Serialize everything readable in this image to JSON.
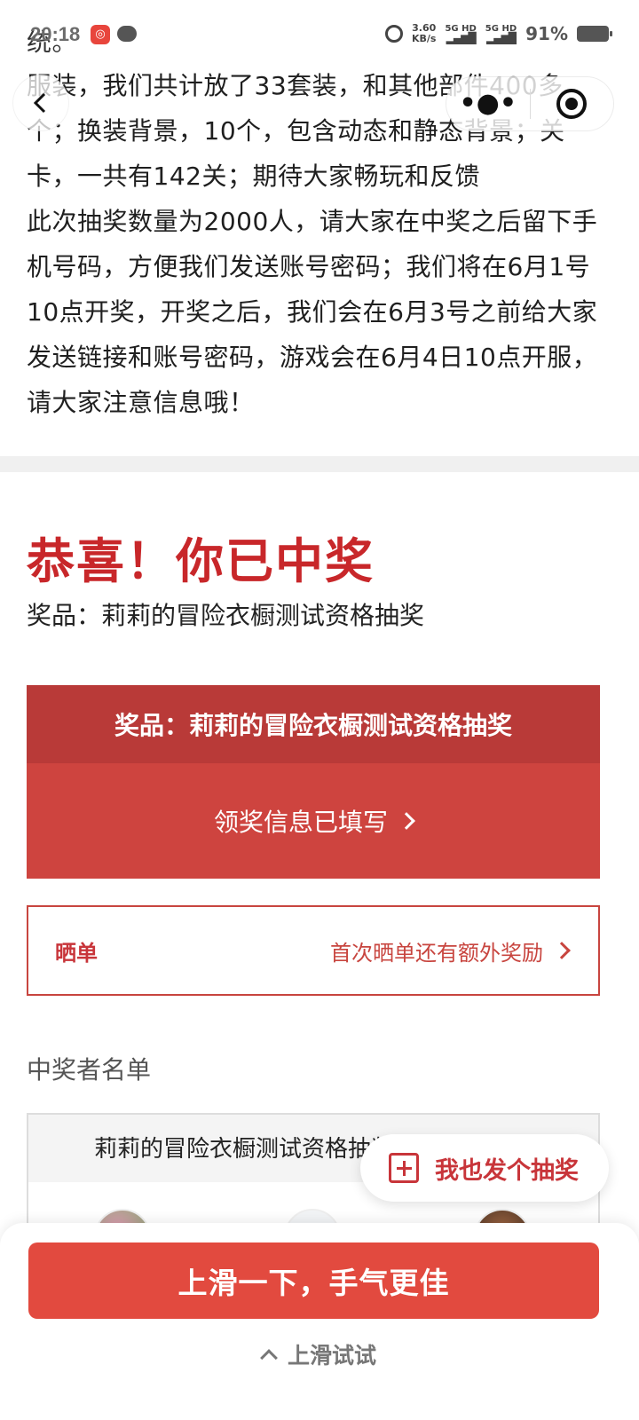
{
  "statusbar": {
    "time": "20:18",
    "net_speed_value": "3.60",
    "net_speed_unit": "KB/s",
    "signal1": "5G HD",
    "signal2": "5G HD",
    "battery": "91%"
  },
  "article": {
    "line_cut": "统。",
    "paragraph1": "服装，我们共计放了33套装，和其他部件400多个；换装背景，10个，包含动态和静态背景；关卡，一共有142关；期待大家畅玩和反馈",
    "paragraph2": "此次抽奖数量为2000人，请大家在中奖之后留下手机号码，方便我们发送账号密码；我们将在6月1号10点开奖，开奖之后，我们会在6月3号之前给大家发送链接和账号密码，游戏会在6月4日10点开服，请大家注意信息哦！"
  },
  "result": {
    "title": "恭喜！你已中奖",
    "prize_line": "奖品：莉莉的冒险衣橱测试资格抽奖"
  },
  "prize_card": {
    "header": "奖品：莉莉的冒险衣橱测试资格抽奖",
    "action": "领奖信息已填写"
  },
  "share": {
    "label": "晒单",
    "hint": "首次晒单还有额外奖励"
  },
  "winners": {
    "title": "中奖者名单",
    "row_header": "莉莉的冒险衣橱测试资格抽奖"
  },
  "fab": {
    "label": "我也发个抽奖"
  },
  "bottom": {
    "cta": "上滑一下，手气更佳",
    "hint": "上滑试试"
  },
  "colors": {
    "accent": "#c8272a",
    "card_head": "#b93a38",
    "card_body": "#ce443f",
    "cta": "#e24a3f"
  }
}
